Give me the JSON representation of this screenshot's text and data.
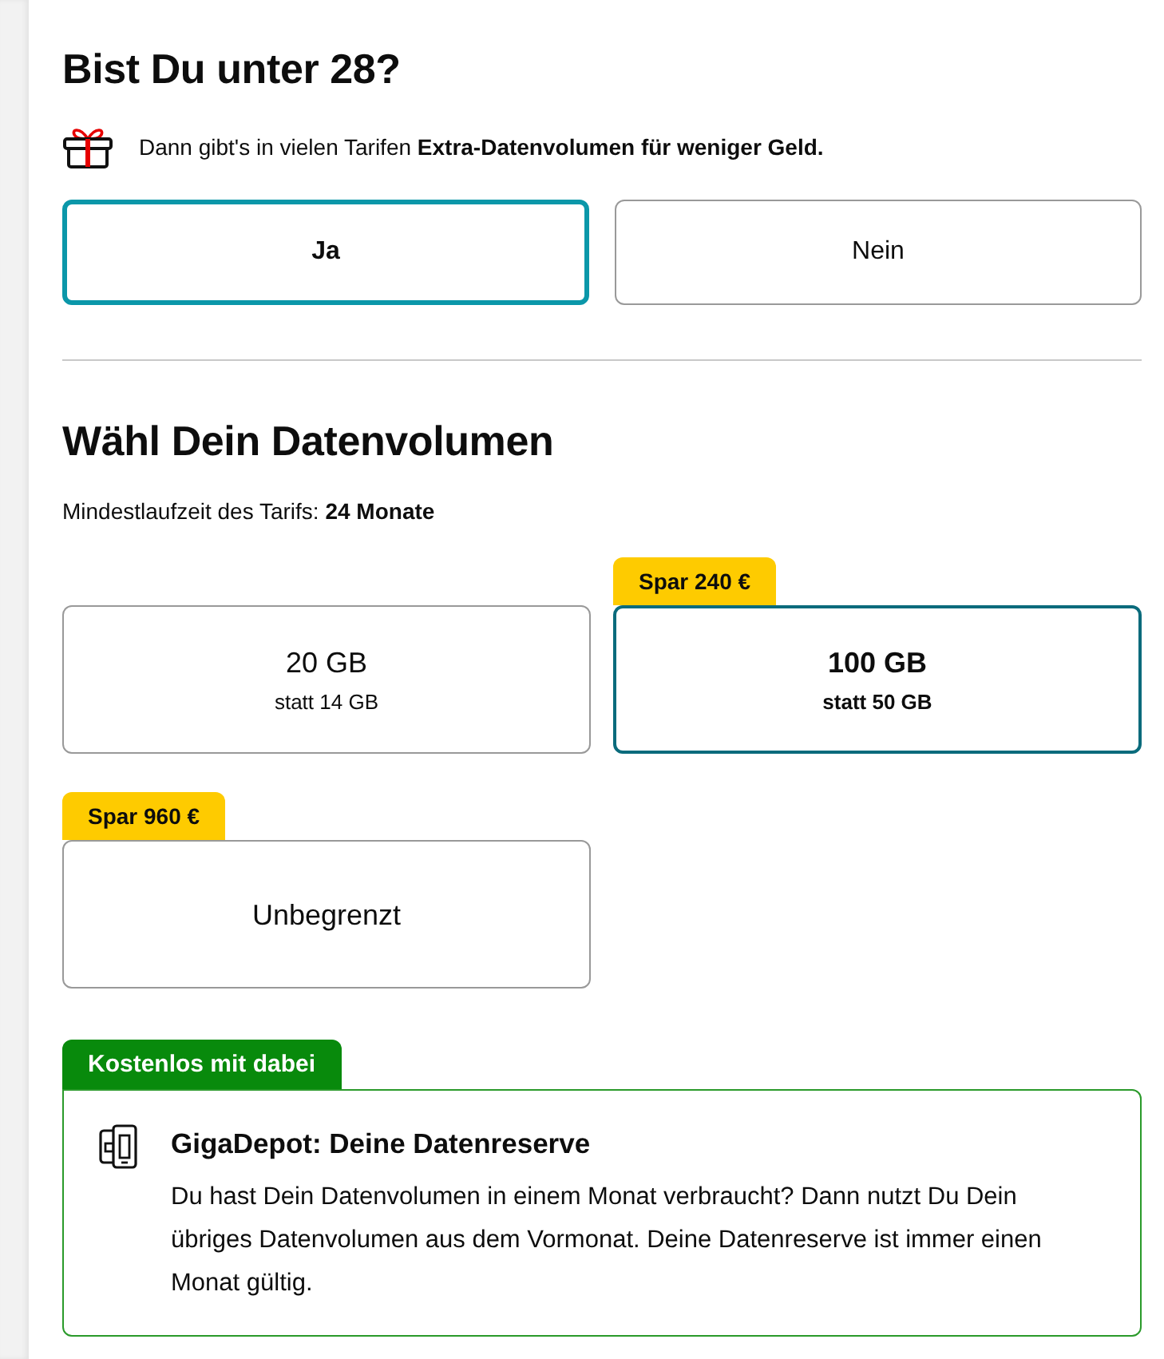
{
  "age_question": {
    "title": "Bist Du unter 28?",
    "hint": "Dann gibt's in vielen Tarifen **Extra-Datenvolumen für weniger Geld.**",
    "options": [
      {
        "label": "Ja",
        "selected": true
      },
      {
        "label": "Nein",
        "selected": false
      }
    ]
  },
  "data_volume": {
    "title": "Wähl Dein Datenvolumen",
    "term": "Mindestlaufzeit des Tarifs: **24 Monate**",
    "options": [
      {
        "label": "20 GB",
        "sublabel": "statt 14 GB",
        "selected": false
      },
      {
        "badge": "Spar 240 €",
        "label": "100 GB",
        "sublabel": "statt 50 GB",
        "selected": true
      },
      {
        "badge": "Spar 960 €",
        "label": "Unbegrenzt",
        "selected": false
      }
    ]
  },
  "included_feature": {
    "badge": "Kostenlos mit dabei",
    "title": "GigaDepot: Deine Datenreserve",
    "text": "Du hast Dein Datenvolumen in einem Monat verbraucht? Dann nutzt Du Dein übriges Datenvolumen aus dem Vormonat. Deine Datenreserve ist immer einen Monat gültig."
  }
}
